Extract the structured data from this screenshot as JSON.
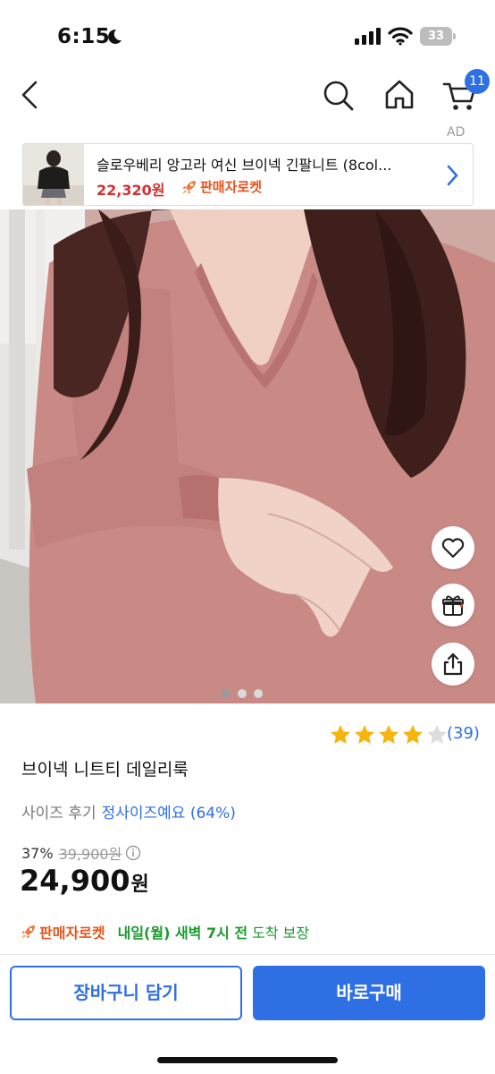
{
  "status_bar": {
    "time": "6:15",
    "battery": "33",
    "icons": [
      "moon-icon",
      "cellular-signal-icon",
      "wifi-icon",
      "battery-icon"
    ]
  },
  "nav": {
    "icons": [
      "chevron-left-icon",
      "search-icon",
      "home-icon",
      "cart-icon"
    ],
    "cart_badge": "11"
  },
  "ad": {
    "label": "AD",
    "title": "슬로우베리 앙고라 여신 브이넥 긴팔니트 (8col...",
    "price": "22,320원",
    "rocket_text": "판매자로켓"
  },
  "gallery": {
    "slide_count": 3,
    "active_slide": 1,
    "actions": [
      "heart-icon",
      "gift-icon",
      "share-icon"
    ]
  },
  "product": {
    "rating": 4,
    "rating_max": 5,
    "review_count": "(39)",
    "name": "브이넥 니트티 데일리룩",
    "size_label": "사이즈 후기",
    "size_value": "정사이즈예요 (64%)",
    "discount_rate": "37%",
    "original_price": "39,900원",
    "sale_price": "24,900",
    "sale_currency": "원",
    "rocket_text": "판매자로켓",
    "delivery_bold": "내일(월) 새벽 7시 전",
    "delivery_plain": "도착 보장"
  },
  "actions": {
    "add_to_cart": "장바구니 담기",
    "buy_now": "바로구매"
  },
  "colors": {
    "accent": "#2f6fe4",
    "price_red": "#d32f2f",
    "rocket_orange": "#e5541c",
    "delivery_green": "#1a9a2e",
    "star_yellow": "#f5b50e"
  }
}
